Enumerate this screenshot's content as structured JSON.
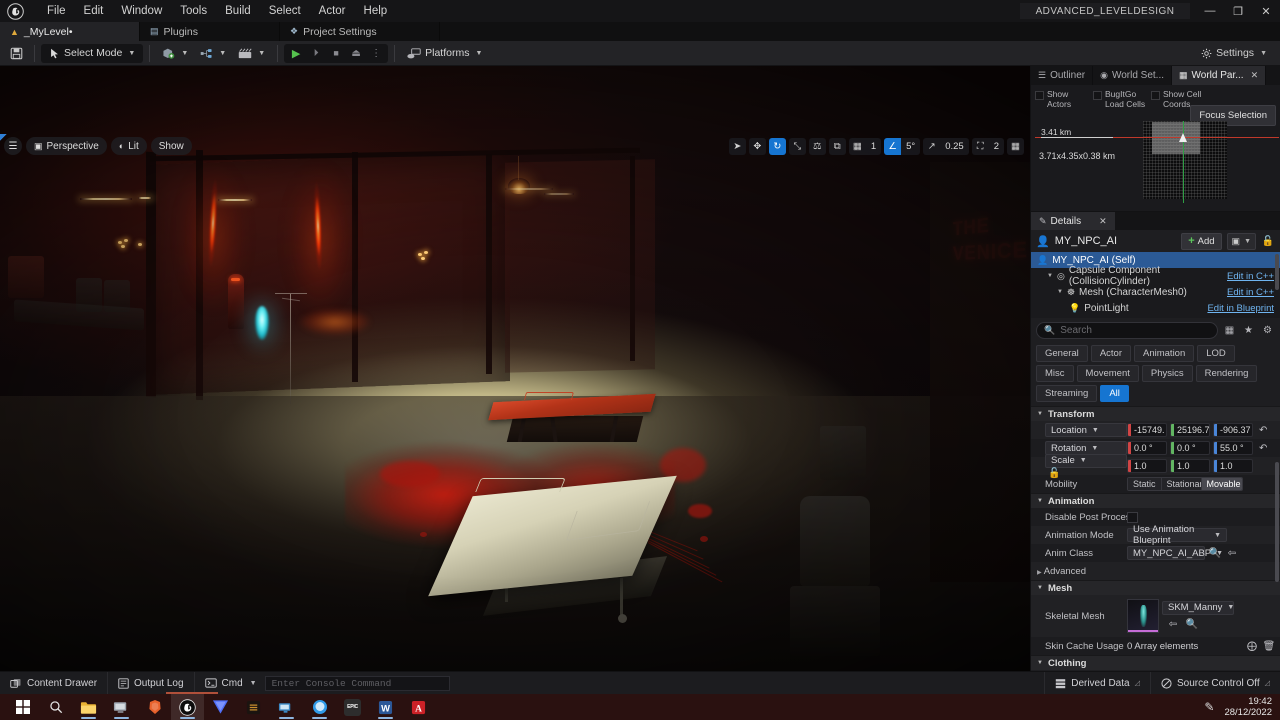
{
  "titlebar": {
    "menus": [
      "File",
      "Edit",
      "Window",
      "Tools",
      "Build",
      "Select",
      "Actor",
      "Help"
    ],
    "project_name": "ADVANCED_LEVELDESIGN",
    "minimize": "—",
    "maximize": "❐",
    "close": "✕",
    "logo_icon": "unreal-engine-logo"
  },
  "tabs": [
    {
      "label": "_MyLevel•",
      "icon": "level-icon",
      "active": true
    },
    {
      "label": "Plugins",
      "icon": "plugins-icon",
      "active": false
    },
    {
      "label": "Project Settings",
      "icon": "project-settings-icon",
      "active": false
    }
  ],
  "toolbar": {
    "save_icon": "save-icon",
    "select_mode": "Select Mode",
    "add_icon": "add-actor-icon",
    "blueprints_icon": "blueprints-icon",
    "cinematics_icon": "cinematics-icon",
    "play": "▶",
    "skip": "⏵",
    "stop": "■",
    "eject": "⏏",
    "more": "⋮",
    "platforms": "Platforms",
    "settings": "Settings"
  },
  "viewport": {
    "menu_icon": "viewport-menu-icon",
    "camera_mode": "Perspective",
    "view_mode": "Lit",
    "show_menu": "Show",
    "tools": [
      {
        "name": "select-tool",
        "glyph": "➤",
        "active": false
      },
      {
        "name": "move-tool",
        "glyph": "✥",
        "active": false
      },
      {
        "name": "rotate-tool",
        "glyph": "↻",
        "active": true
      },
      {
        "name": "scale-tool",
        "glyph": "⤡",
        "active": false
      },
      {
        "name": "coordinate-system-tool",
        "glyph": "⚖",
        "active": false
      },
      {
        "name": "surface-snap-tool",
        "glyph": "⧉",
        "active": false
      }
    ],
    "grid_snap": {
      "icon": "grid-icon",
      "value": "1",
      "enabled": false
    },
    "angle_snap": {
      "icon": "angle-icon",
      "value": "5°",
      "enabled": true
    },
    "scale_snap": {
      "icon": "scale-snap-icon",
      "value": "0.25",
      "enabled": false
    },
    "camera_speed": {
      "icon": "camera-icon",
      "value": "2",
      "enabled": false
    },
    "layout_icon": "viewport-layout-icon",
    "scene_neon_sign": [
      "THE",
      "VENICE"
    ]
  },
  "right_panel": {
    "tabs": [
      {
        "label": "Outliner",
        "icon": "outliner-icon",
        "active": false,
        "closable": false
      },
      {
        "label": "World Set...",
        "icon": "world-settings-icon",
        "active": false,
        "closable": false
      },
      {
        "label": "World Par...",
        "icon": "world-partition-icon",
        "active": true,
        "closable": true
      }
    ],
    "world_partition": {
      "checkboxes": [
        "Show Actors",
        "BugItGo Load Cells",
        "Show Cell Coords"
      ],
      "focus_button": "Focus Selection",
      "scale_label": "3.41 km",
      "dimensions": "3.71x4.35x0.38 km"
    }
  },
  "details": {
    "tab_label": "Details",
    "tab_icon": "details-icon",
    "close_icon": "✕",
    "actor_icon": "actor-icon",
    "actor_name": "MY_NPC_AI",
    "add_button": "Add",
    "hierarchy_icon": "hierarchy-icon",
    "lock_icon": "unlock-icon",
    "components": [
      {
        "label": "MY_NPC_AI (Self)",
        "link": "",
        "depth": 0,
        "selected": true,
        "icon": "actor-icon",
        "expandable": false
      },
      {
        "label": "Capsule Component (CollisionCylinder)",
        "link": "Edit in C++",
        "depth": 1,
        "selected": false,
        "icon": "capsule-icon",
        "expandable": true
      },
      {
        "label": "Mesh (CharacterMesh0)",
        "link": "Edit in C++",
        "depth": 2,
        "selected": false,
        "icon": "mesh-icon",
        "expandable": true
      },
      {
        "label": "PointLight",
        "link": "Edit in Blueprint",
        "depth": 3,
        "selected": false,
        "icon": "light-icon",
        "expandable": false
      }
    ],
    "search_placeholder": "Search",
    "search_value": "",
    "search_icon": "search-icon",
    "column_icon": "column-view-icon",
    "favorite_icon": "star-icon",
    "settings_icon": "gear-icon",
    "filters": [
      {
        "label": "General",
        "active": false
      },
      {
        "label": "Actor",
        "active": false
      },
      {
        "label": "Animation",
        "active": false
      },
      {
        "label": "LOD",
        "active": false
      },
      {
        "label": "Misc",
        "active": false
      },
      {
        "label": "Movement",
        "active": false
      },
      {
        "label": "Physics",
        "active": false
      },
      {
        "label": "Rendering",
        "active": false
      },
      {
        "label": "Streaming",
        "active": false
      },
      {
        "label": "All",
        "active": true
      }
    ],
    "sections": {
      "transform": {
        "title": "Transform",
        "location": {
          "label": "Location",
          "x": "-15749.",
          "y": "25196.7",
          "z": "-906.37"
        },
        "rotation": {
          "label": "Rotation",
          "x": "0.0 °",
          "y": "0.0 °",
          "z": "55.0 °"
        },
        "scale": {
          "label": "Scale",
          "x": "1.0",
          "y": "1.0",
          "z": "1.0"
        },
        "mobility": {
          "label": "Mobility",
          "options": [
            "Static",
            "Stationary",
            "Movable"
          ],
          "selected": "Movable"
        }
      },
      "animation": {
        "title": "Animation",
        "disable_post_process": {
          "label": "Disable Post Process...",
          "checked": false
        },
        "animation_mode": {
          "label": "Animation Mode",
          "value": "Use Animation Blueprint"
        },
        "anim_class": {
          "label": "Anim Class",
          "value": "MY_NPC_AI_ABP"
        },
        "advanced": "Advanced"
      },
      "mesh": {
        "title": "Mesh",
        "skeletal_mesh": {
          "label": "Skeletal Mesh",
          "value": "SKM_Manny"
        },
        "skin_cache": {
          "label": "Skin Cache Usage",
          "value": "0 Array elements"
        }
      },
      "clothing": {
        "title": "Clothing"
      }
    }
  },
  "statusbar": {
    "content_drawer": "Content Drawer",
    "content_drawer_icon": "drawer-icon",
    "output_log": "Output Log",
    "output_log_icon": "log-icon",
    "cmd": "Cmd",
    "cmd_icon": "console-icon",
    "console_placeholder": "Enter Console Command",
    "derived_data": "Derived Data",
    "derived_data_icon": "derived-data-icon",
    "source_control": "Source Control Off",
    "source_control_icon": "source-control-icon"
  },
  "taskbar": {
    "start_icon": "windows-start-icon",
    "search_icon": "search-icon",
    "apps": [
      {
        "name": "file-explorer-icon",
        "color": "#e8b23a",
        "glyph": "▰",
        "active": false
      },
      {
        "name": "remote-desktop-icon",
        "color": "#7d8590",
        "glyph": "☐",
        "active": false
      },
      {
        "name": "brave-browser-icon",
        "color": "#e8622c",
        "glyph": "◆",
        "active": false
      },
      {
        "name": "unreal-engine-icon",
        "color": "#1b1b1b",
        "glyph": "U",
        "active": true
      },
      {
        "name": "bitwarden-icon",
        "color": "#3b5ee8",
        "glyph": "▼",
        "active": false
      },
      {
        "name": "substance-icon",
        "color": "#b07020",
        "glyph": "■",
        "active": false
      },
      {
        "name": "remote-connection-icon",
        "color": "#3c8fd0",
        "glyph": "▣",
        "active": false
      },
      {
        "name": "messenger-icon",
        "color": "#2f9ae8",
        "glyph": "●",
        "active": false
      },
      {
        "name": "epic-games-icon",
        "color": "#2a2a2a",
        "glyph": "EPIC",
        "active": false
      },
      {
        "name": "word-icon",
        "color": "#2b5797",
        "glyph": "W",
        "active": false
      },
      {
        "name": "acrobat-icon",
        "color": "#cc2127",
        "glyph": "A",
        "active": false
      }
    ],
    "tray_icon": "pen-icon",
    "time": "19:42",
    "date": "28/12/2022"
  }
}
